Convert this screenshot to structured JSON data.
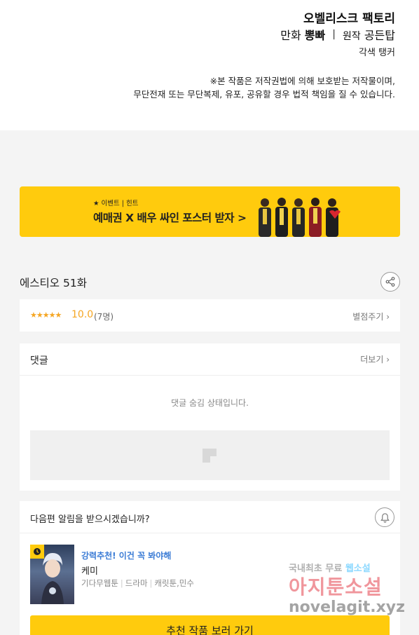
{
  "credits": {
    "studio": "오벨리스크 팩토리",
    "artist_role": "만화",
    "artist_name": "뽕빠",
    "separator": "|",
    "original_role": "원작",
    "original_author": "공든탑",
    "colorist": "각색 탱커",
    "notice_line1": "※본 작품은 저작권법에 의해 보호받는 저작물이며,",
    "notice_line2": "무단전재 또는 무단복제, 유포, 공유할 경우 법적 책임을 질 수 있습니다."
  },
  "banner": {
    "tag": "★ 이벤트 | 힌트",
    "title": "예매권 X 배우 싸인 포스터 받자 >",
    "bg_color": "#ffcb0d"
  },
  "episode": {
    "title": "에스티오 51화",
    "share_icon": "share-icon"
  },
  "rating": {
    "stars": "★★★★★",
    "score": "10.0",
    "count": "(7명)",
    "rate_link": "별점주기 ›",
    "star_color": "#f5a623"
  },
  "comments": {
    "title": "댓글",
    "more_link": "더보기 ›",
    "hidden_message": "댓글 숨김 상태입니다."
  },
  "notify": {
    "question": "다음편 알림을 받으시겠습니까?",
    "bell_icon": "bell-icon"
  },
  "recommendation": {
    "promo": "강력추천! 이건 꼭 봐야해",
    "title": "케미",
    "genre1": "기다무웹툰",
    "genre2": "드라마",
    "tags": "캐릿툰,민수",
    "button": "추천 작품 보러 가기",
    "accent_color": "#3a7bd5"
  },
  "watermark": {
    "line1_a": "국내최초 무료 ",
    "line1_b": "웹소설",
    "line2": "아지툰소설",
    "line3": "novelagit.xyz"
  }
}
